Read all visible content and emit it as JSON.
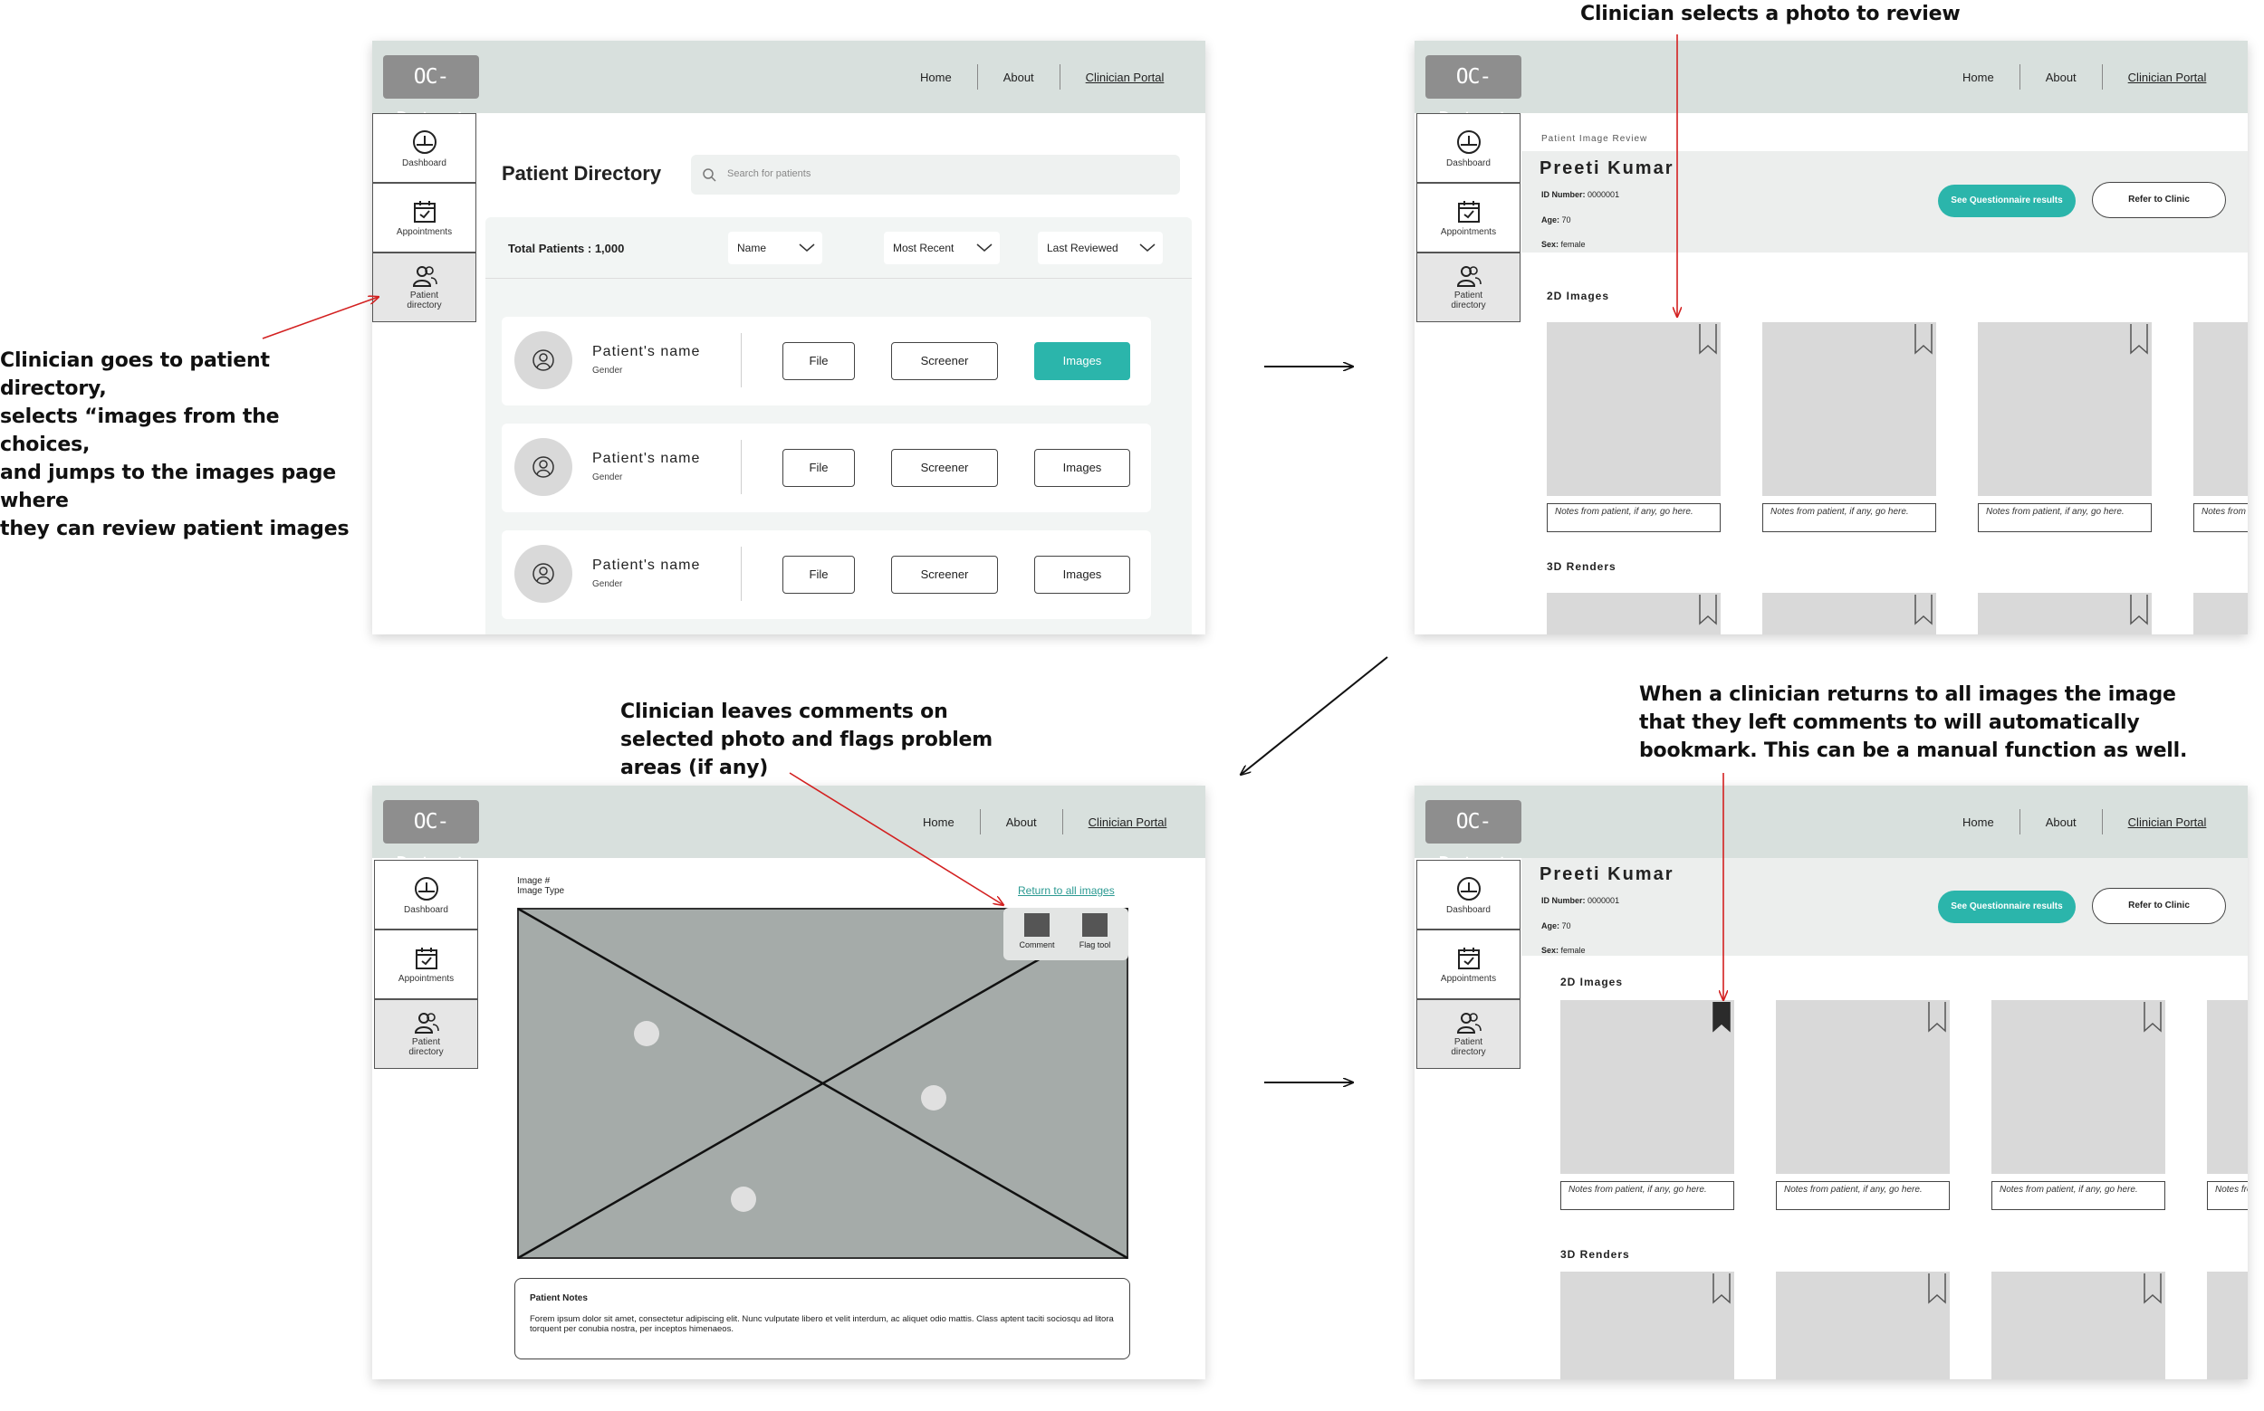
{
  "annotations": {
    "a1": [
      "Clinician goes to patient directory,",
      "selects “images from the choices,",
      "and jumps to the images page where",
      "they can review patient images"
    ],
    "a2": [
      "Clinician selects a photo to review"
    ],
    "a3": [
      "Clinician leaves comments on",
      "selected photo and flags problem",
      "areas (if any)"
    ],
    "a4": [
      "When a clinician returns to all images the image",
      "that they left comments to will automatically",
      "bookmark. This can be a manual function as well."
    ]
  },
  "app": {
    "logo": "OC-Detect",
    "nav": {
      "home": "Home",
      "about": "About",
      "portal": "Clinician Portal"
    },
    "sidebar": {
      "dashboard": "Dashboard",
      "appointments": "Appointments",
      "directory_l1": "Patient",
      "directory_l2": "directory"
    }
  },
  "directory": {
    "title": "Patient Directory",
    "search_placeholder": "Search for patients",
    "total": "Total Patients : 1,000",
    "filters": [
      "Name",
      "Most Recent",
      "Last Reviewed"
    ],
    "patients": [
      {
        "name": "Patient's name",
        "gender": "Gender"
      },
      {
        "name": "Patient's name",
        "gender": "Gender"
      },
      {
        "name": "Patient's name",
        "gender": "Gender"
      }
    ],
    "btn_file": "File",
    "btn_screener": "Screener",
    "btn_images": "Images"
  },
  "review": {
    "breadcrumb": "Patient Image Review",
    "patient_name": "Preeti Kumar",
    "id_label": "ID Number:",
    "id_value": "0000001",
    "age_label": "Age:",
    "age_value": "70",
    "sex_label": "Sex:",
    "sex_value": "female",
    "questionnaire_btn": "See Questionnaire results",
    "refer_btn": "Refer to Clinic",
    "images_2d": "2D Images",
    "renders_3d": "3D Renders",
    "note_placeholder": "Notes from patient, if any, go here.",
    "note_cut": "Notes from patient, if any, go here."
  },
  "viewer": {
    "image_num": "Image #",
    "image_type": "Image Type",
    "return_link": "Return to all images",
    "comment": "Comment",
    "flag": "Flag tool",
    "notes_title": "Patient Notes",
    "notes_text": "Forem ipsum dolor sit amet, consectetur adipiscing elit. Nunc vulputate libero et velit interdum, ac aliquet odio mattis. Class aptent taciti sociosqu ad litora torquent per conubia nostra, per inceptos himenaeos."
  },
  "colors": {
    "teal": "#2bb5ab",
    "header": "#d8e0dd",
    "red_arrow": "#d32020"
  }
}
